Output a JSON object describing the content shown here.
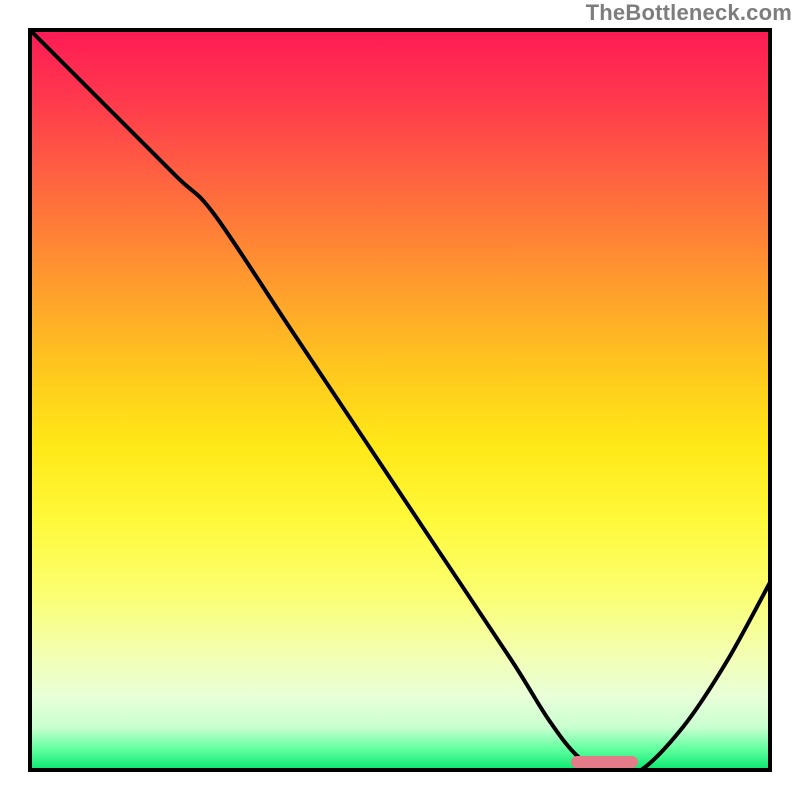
{
  "attribution": "TheBottleneck.com",
  "chart_data": {
    "type": "line",
    "title": "",
    "xlabel": "",
    "ylabel": "",
    "xlim": [
      0,
      100
    ],
    "ylim": [
      0,
      100
    ],
    "grid": false,
    "legend": false,
    "series": [
      {
        "name": "bottleneck-curve",
        "x": [
          0,
          10,
          20,
          25,
          35,
          45,
          55,
          65,
          70,
          74,
          78,
          82,
          88,
          94,
          100
        ],
        "values": [
          100,
          90,
          80,
          75,
          60,
          45,
          30,
          15,
          7,
          2,
          0,
          0,
          6,
          15,
          26
        ]
      }
    ],
    "optimum_range_pct": {
      "start": 73,
      "end": 82
    },
    "background_gradient": {
      "top": "#ff1a55",
      "mid": "#ffe817",
      "bottom": "#00e56a"
    }
  }
}
